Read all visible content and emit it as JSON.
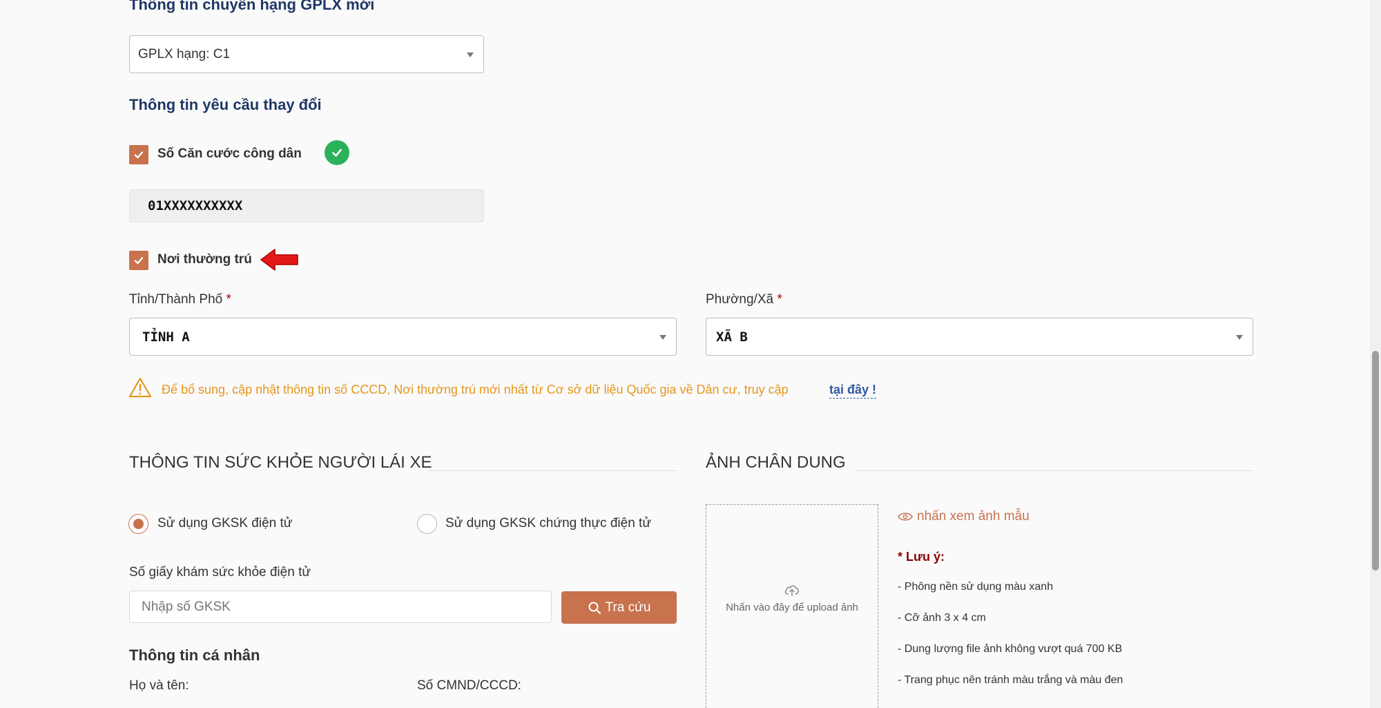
{
  "license_info": {
    "title": "Thông tin chuyển hạng GPLX mới",
    "class_select": "GPLX hạng: C1"
  },
  "change_request": {
    "title": "Thông tin yêu cầu thay đổi",
    "cccd_label": "Số Căn cước công dân",
    "cccd_value": "01XXXXXXXXXX",
    "residence_label": "Nơi thường trú",
    "province_label": "Tỉnh/Thành Phố",
    "province_value": "TỈNH A",
    "ward_label": "Phường/Xã",
    "ward_value": "XÃ B",
    "required_mark": "*",
    "warning_text": "Để bổ sung, cập nhật thông tin số CCCD, Nơi thường trú mới nhất từ Cơ sở dữ liệu Quốc gia về Dân cư, truy cập",
    "warning_link": "tại đây !"
  },
  "health": {
    "title": "THÔNG TIN SỨC KHỎE NGƯỜI LÁI XE",
    "radio_electronic": "Sử dụng GKSK điện tử",
    "radio_certified": "Sử dụng GKSK chứng thực điện tử",
    "gksk_label": "Số giấy khám sức khỏe điện tử",
    "gksk_placeholder": "Nhập số GKSK",
    "lookup_button": "Tra cứu"
  },
  "personal": {
    "title": "Thông tin cá nhân",
    "name_label": "Họ và tên:",
    "id_label": "Số CMND/CCCD:"
  },
  "portrait": {
    "title": "ẢNH CHÂN DUNG",
    "upload_text": "Nhấn vào đây để upload ảnh",
    "sample_link": "nhấn xem ảnh mẫu",
    "note_title": "* Lưu ý:",
    "notes": [
      "- Phông nền sử dụng màu xanh",
      "- Cỡ ảnh 3 x 4 cm",
      "- Dung lượng file ảnh không vượt quá 700 KB",
      "- Trang phục nên tránh màu trắng và màu đen"
    ]
  },
  "colors": {
    "accent": "#c8724e",
    "title_blue": "#1f3864",
    "warning": "#e6961e",
    "success": "#2bb15a"
  }
}
